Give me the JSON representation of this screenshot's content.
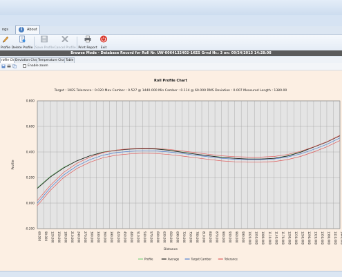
{
  "tabs": {
    "settings": "ngs",
    "about": "About"
  },
  "ribbon": {
    "buttons": [
      {
        "label": "Profile",
        "enabled": true,
        "icon": "pen-icon"
      },
      {
        "label": "Delete Profile",
        "enabled": true,
        "icon": "delete-document-icon"
      },
      {
        "label": "Save Profile",
        "enabled": false,
        "icon": "floppy-disk-icon"
      },
      {
        "label": "Cancel Profile",
        "enabled": false,
        "icon": "cancel-x-icon"
      },
      {
        "label": "Print Report",
        "enabled": true,
        "icon": "printer-icon"
      },
      {
        "label": "Exit",
        "enabled": true,
        "icon": "power-icon"
      }
    ]
  },
  "status": {
    "text": "Browse Mode - Database Record for Roll Nr. UW-0064132402-1KES Grnd Nr.: 3 on: 09/24/2013 14:28:08"
  },
  "subtabs": [
    "rofile Chart",
    "Deviation Chart",
    "Temperature Chart",
    "Table"
  ],
  "toolstrip": {
    "enable_zoom": "Enable zoom",
    "zoom_checked": false
  },
  "chart_data": {
    "type": "line",
    "title": "Roll Profile Chart",
    "info": "Target : 1KES    Tolerance : 0.020    Max Camber : 0.527 @ 1440.000    Min Camber : 0.114 @ 60.000    RMS Deviation : 0.007    Measured Length : 1380.00",
    "xlabel": "Distance",
    "ylabel": "Profile",
    "ylim": [
      -0.2,
      0.8
    ],
    "yticks": [
      "0.800",
      "0.600",
      "0.400",
      "0.200",
      "0.000",
      "-0.200"
    ],
    "xticks": [
      "60.000",
      "90.000",
      "120.000",
      "150.000",
      "180.000",
      "210.000",
      "240.000",
      "270.000",
      "300.000",
      "330.000",
      "360.000",
      "390.000",
      "420.000",
      "450.000",
      "480.000",
      "510.000",
      "540.000",
      "570.000",
      "600.000",
      "630.000",
      "660.000",
      "690.000",
      "720.000",
      "750.000",
      "780.000",
      "810.000",
      "840.000",
      "870.000",
      "900.000",
      "930.000",
      "960.000",
      "990.000",
      "1020.000",
      "1050.000",
      "1080.000",
      "1110.000",
      "1140.000",
      "1170.000",
      "1200.000",
      "1230.000",
      "1260.000",
      "1290.000",
      "1320.000",
      "1350.000",
      "1380.000",
      "1410.000",
      "1440.000"
    ],
    "x": [
      60,
      120,
      180,
      240,
      300,
      360,
      420,
      480,
      540,
      600,
      660,
      720,
      780,
      840,
      900,
      960,
      1020,
      1080,
      1140,
      1200,
      1260,
      1320,
      1380,
      1440
    ],
    "series": [
      {
        "name": "Profile",
        "color": "#7fd37f",
        "values": [
          0.12,
          0.21,
          0.28,
          0.33,
          0.37,
          0.4,
          0.415,
          0.425,
          0.43,
          0.425,
          0.415,
          0.4,
          0.385,
          0.37,
          0.36,
          0.35,
          0.345,
          0.345,
          0.35,
          0.37,
          0.4,
          0.44,
          0.48,
          0.53
        ]
      },
      {
        "name": "Average",
        "color": "#222222",
        "values": [
          0.115,
          0.205,
          0.275,
          0.33,
          0.37,
          0.398,
          0.413,
          0.422,
          0.426,
          0.423,
          0.413,
          0.398,
          0.383,
          0.37,
          0.358,
          0.35,
          0.345,
          0.345,
          0.35,
          0.368,
          0.398,
          0.438,
          0.478,
          0.527
        ]
      },
      {
        "name": "Target Camber",
        "color": "#4f7fd1",
        "values": [
          0.0,
          0.12,
          0.22,
          0.29,
          0.34,
          0.375,
          0.395,
          0.405,
          0.41,
          0.408,
          0.4,
          0.388,
          0.375,
          0.362,
          0.35,
          0.343,
          0.34,
          0.34,
          0.345,
          0.36,
          0.385,
          0.42,
          0.46,
          0.51
        ]
      },
      {
        "name": "Tolerance",
        "color": "#e05a5a",
        "values": [
          0.02,
          0.14,
          0.24,
          0.31,
          0.36,
          0.395,
          0.415,
          0.425,
          0.43,
          0.428,
          0.42,
          0.408,
          0.395,
          0.382,
          0.37,
          0.363,
          0.36,
          0.36,
          0.365,
          0.38,
          0.405,
          0.44,
          0.48,
          0.53
        ]
      },
      {
        "name": "Tolerance",
        "color": "#e05a5a",
        "values": [
          -0.02,
          0.1,
          0.2,
          0.27,
          0.32,
          0.355,
          0.375,
          0.385,
          0.39,
          0.388,
          0.38,
          0.368,
          0.355,
          0.342,
          0.33,
          0.323,
          0.32,
          0.32,
          0.325,
          0.34,
          0.365,
          0.4,
          0.44,
          0.49
        ]
      }
    ],
    "legend": [
      "Profile",
      "Average",
      "Target Camber",
      "Tolerance"
    ],
    "legend_position": "bottom",
    "grid": true
  }
}
